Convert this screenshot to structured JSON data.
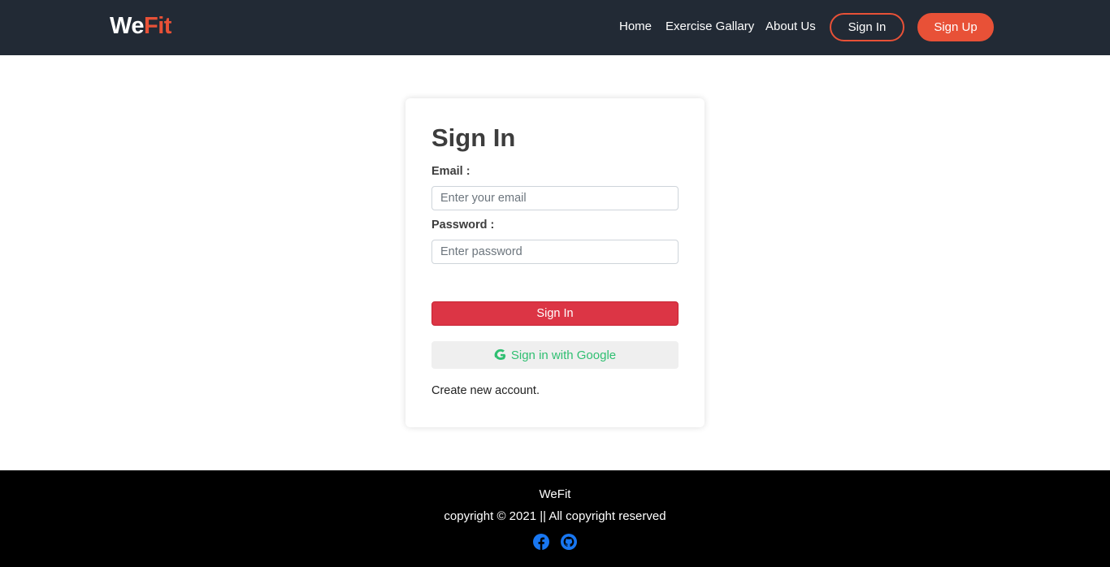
{
  "header": {
    "brand_part1": "We",
    "brand_part2": "Fit",
    "nav": {
      "home": "Home",
      "exercise_gallery": "Exercise Gallary",
      "about_us": "About Us",
      "sign_in": "Sign In",
      "sign_up": "Sign Up"
    }
  },
  "form": {
    "title": "Sign In",
    "email_label": "Email :",
    "email_placeholder": "Enter your email",
    "password_label": "Password :",
    "password_placeholder": "Enter password",
    "submit_label": "Sign In",
    "google_label": "Sign in with Google",
    "create_account": "Create new account."
  },
  "footer": {
    "brand": "WeFit",
    "copyright": "copyright © 2021 || All copyright reserved",
    "icons": [
      "facebook-icon",
      "github-icon"
    ]
  },
  "colors": {
    "header_bg": "#222a35",
    "accent": "#e85137",
    "submit": "#dc3545",
    "google_text": "#2fbf71",
    "footer_bg": "#000000",
    "social_icons": "#1877f2"
  }
}
